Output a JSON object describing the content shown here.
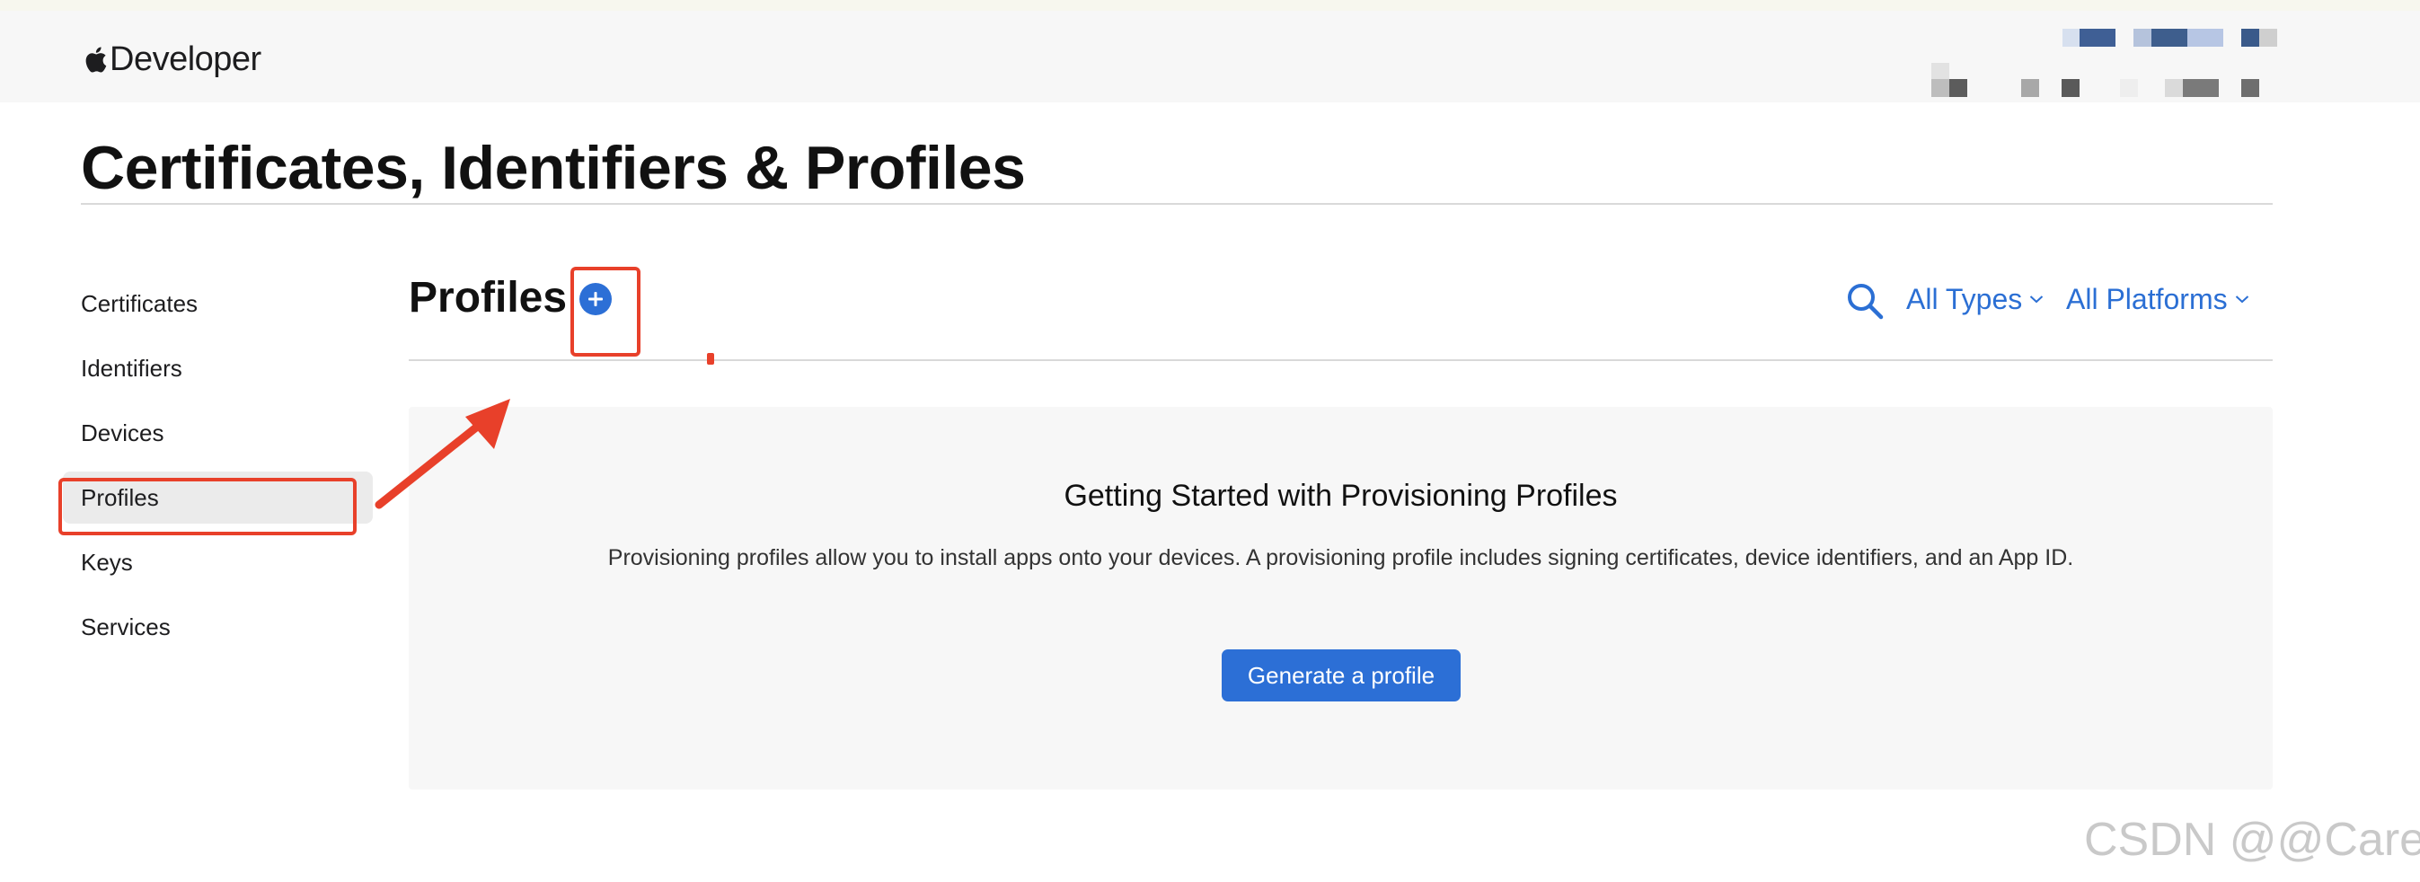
{
  "header": {
    "brand": "Developer"
  },
  "page": {
    "title": "Certificates, Identifiers & Profiles"
  },
  "sidebar": {
    "items": [
      {
        "label": "Certificates"
      },
      {
        "label": "Identifiers"
      },
      {
        "label": "Devices"
      },
      {
        "label": "Profiles",
        "active": true
      },
      {
        "label": "Keys"
      },
      {
        "label": "Services"
      }
    ]
  },
  "section": {
    "title": "Profiles",
    "filters": {
      "types": "All Types",
      "platforms": "All Platforms"
    }
  },
  "empty_state": {
    "heading": "Getting Started with Provisioning Profiles",
    "description": "Provisioning profiles allow you to install apps onto your devices. A provisioning profile includes signing certificates, device identifiers, and an App ID.",
    "button_label": "Generate a profile"
  },
  "watermark": "CSDN @@Carey",
  "colors": {
    "accent": "#2c6fd6",
    "link": "#2b6fd4",
    "annotation": "#e8402a"
  }
}
